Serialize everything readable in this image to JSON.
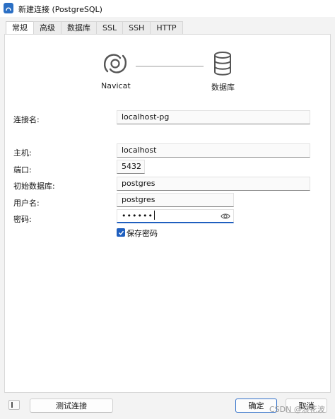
{
  "window": {
    "title": "新建连接 (PostgreSQL)"
  },
  "tabs": [
    "常规",
    "高级",
    "数据库",
    "SSL",
    "SSH",
    "HTTP"
  ],
  "logos": {
    "left_label": "Navicat",
    "right_label": "数据库"
  },
  "form": {
    "connection_name_label": "连接名:",
    "connection_name_value": "localhost-pg",
    "host_label": "主机:",
    "host_value": "localhost",
    "port_label": "端口:",
    "port_value": "5432",
    "initial_db_label": "初始数据库:",
    "initial_db_value": "postgres",
    "username_label": "用户名:",
    "username_value": "postgres",
    "password_label": "密码:",
    "password_value": "••••••",
    "save_password_label": "保存密码",
    "save_password_checked": true
  },
  "buttons": {
    "test": "测试连接",
    "ok": "确定",
    "cancel": "取消"
  },
  "watermark": "CSDN @浪花波",
  "colors": {
    "accent": "#1f5fbf",
    "app_icon": "#2b6fc4"
  },
  "icons": [
    "navicat-logo-icon",
    "database-icon",
    "eye-icon",
    "checkmark-icon",
    "panel-toggle-icon"
  ]
}
